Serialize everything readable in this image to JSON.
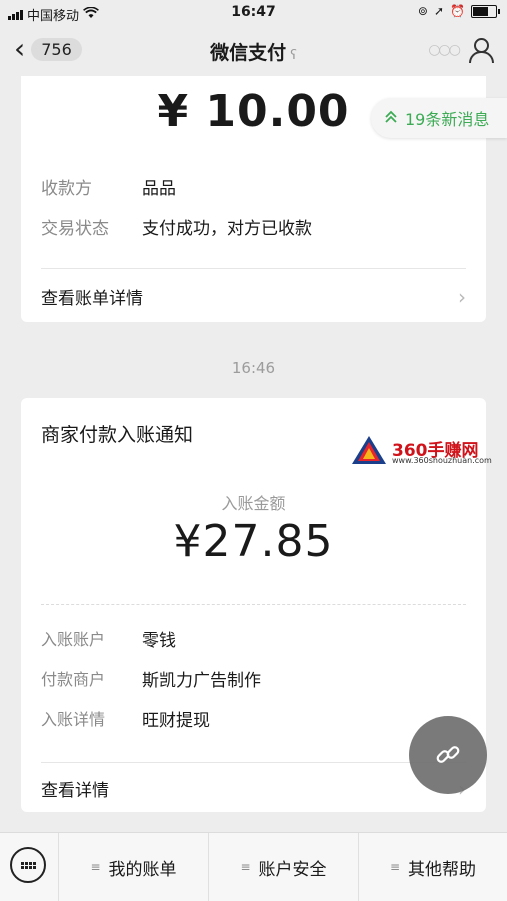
{
  "status_bar": {
    "carrier": "中国移动",
    "time": "16:47"
  },
  "nav": {
    "back_count": "756",
    "title": "微信支付"
  },
  "payment": {
    "amount": "¥ 10.00",
    "rows": [
      {
        "key": "收款方",
        "value": "品品"
      },
      {
        "key": "交易状态",
        "value": "支付成功，对方已收款"
      }
    ],
    "detail_link": "查看账单详情"
  },
  "new_messages": "19条新消息",
  "timestamp": "16:46",
  "notice": {
    "title": "商家付款入账通知",
    "amount_label": "入账金额",
    "amount": "¥27.85",
    "rows": [
      {
        "key": "入账账户",
        "value": "零钱"
      },
      {
        "key": "付款商户",
        "value": "斯凯力广告制作"
      },
      {
        "key": "入账详情",
        "value": "旺财提现"
      }
    ],
    "detail_link": "查看详情"
  },
  "watermark": {
    "name": "360手赚网",
    "url": "www.360shouzhuan.com"
  },
  "bottom_tabs": [
    "我的账单",
    "账户安全",
    "其他帮助"
  ],
  "colors": {
    "accent_green": "#3dab55",
    "watermark_red": "#d0131b"
  }
}
